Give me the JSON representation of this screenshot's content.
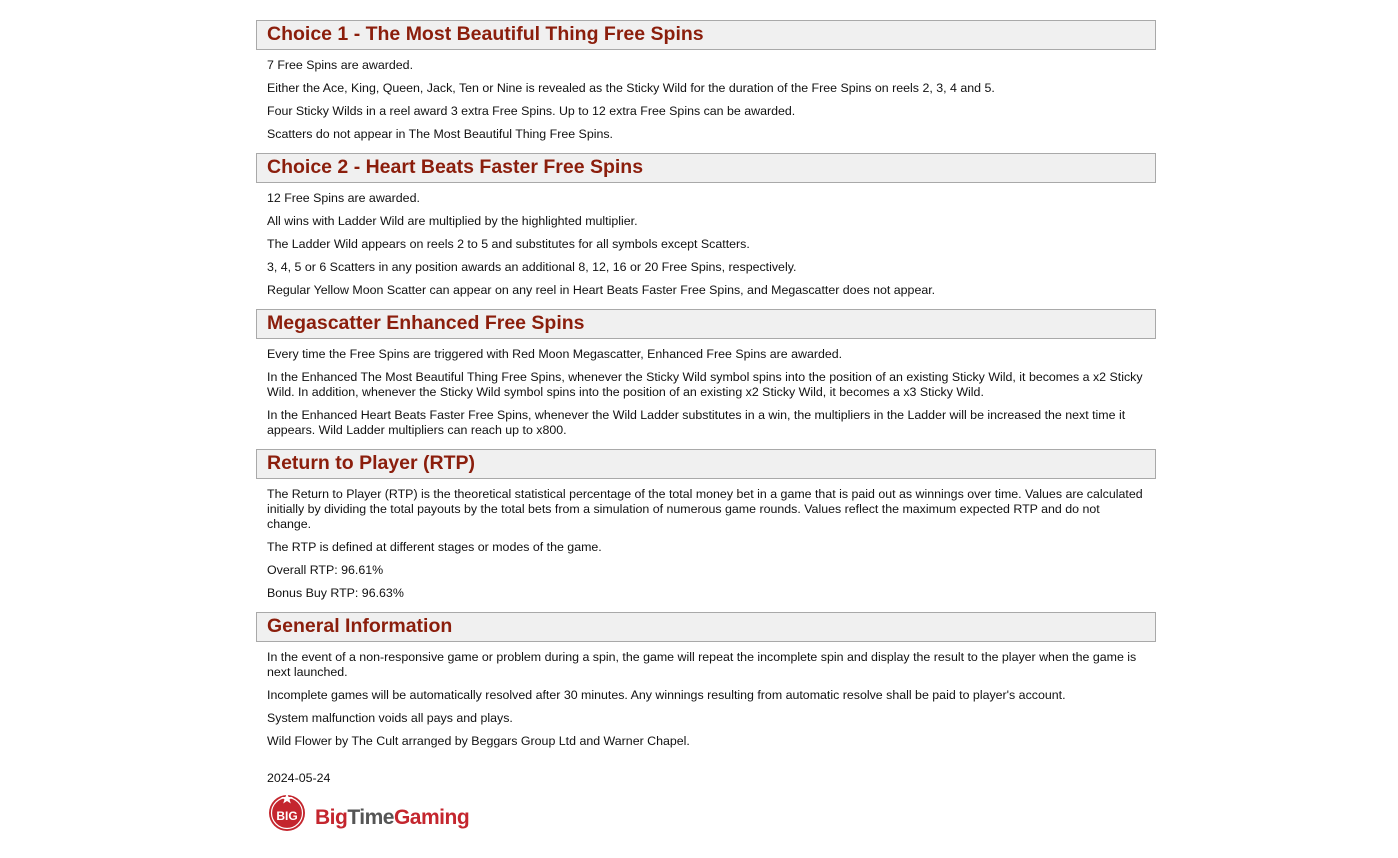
{
  "sections": [
    {
      "title": "Choice 1 - The Most Beautiful Thing Free Spins",
      "paragraphs": [
        "7 Free Spins are awarded.",
        "Either the Ace, King, Queen, Jack, Ten or Nine is revealed as the Sticky Wild for the duration of the Free Spins on reels 2, 3, 4 and 5.",
        "Four Sticky Wilds in a reel award 3 extra Free Spins. Up to 12 extra Free Spins can be awarded.",
        "Scatters do not appear in The Most Beautiful Thing Free Spins."
      ]
    },
    {
      "title": "Choice 2 - Heart Beats Faster Free Spins",
      "paragraphs": [
        "12 Free Spins are awarded.",
        "All wins with Ladder Wild are multiplied by the highlighted multiplier.",
        "The Ladder Wild appears on reels 2 to 5 and substitutes for all symbols except Scatters.",
        "3, 4, 5 or 6 Scatters in any position awards an additional 8, 12, 16 or 20 Free Spins, respectively.",
        "Regular Yellow Moon Scatter can appear on any reel in Heart Beats Faster Free Spins, and Megascatter does not appear."
      ]
    },
    {
      "title": "Megascatter Enhanced Free Spins",
      "paragraphs": [
        "Every time the Free Spins are triggered with Red Moon Megascatter, Enhanced Free Spins are awarded.",
        "In the Enhanced The Most Beautiful Thing Free Spins, whenever the Sticky Wild symbol spins into the position of an existing Sticky Wild, it becomes a x2 Sticky Wild. In addition, whenever the Sticky Wild symbol spins into the position of an existing x2 Sticky Wild, it becomes a x3 Sticky Wild.",
        "In the Enhanced Heart Beats Faster Free Spins, whenever the Wild Ladder substitutes in a win, the multipliers in the Ladder will be increased the next time it appears. Wild Ladder multipliers can reach up to x800."
      ]
    },
    {
      "title": "Return to Player (RTP)",
      "paragraphs": [
        "The Return to Player (RTP) is the theoretical statistical percentage of the total money bet in a game that is paid out as winnings over time. Values are calculated initially by dividing the total payouts by the total bets from a simulation of numerous game rounds. Values reflect the maximum expected RTP and do not change.",
        "The RTP is defined at different stages or modes of the game.",
        "Overall RTP: 96.61%",
        "Bonus Buy RTP: 96.63%"
      ]
    },
    {
      "title": "General Information",
      "paragraphs": [
        "In the event of a non-responsive game or problem during a spin, the game will repeat the incomplete spin and display the result to the player when the game is next launched.",
        "Incomplete games will be automatically resolved after 30 minutes. Any winnings resulting from automatic resolve shall be paid to player's account.",
        "System malfunction voids all pays and plays.",
        "Wild Flower by The Cult arranged by Beggars Group Ltd and Warner Chapel."
      ]
    }
  ],
  "footer": {
    "date": "2024-05-24",
    "logo_badge_text": "BIG",
    "logo_text_1": "Big",
    "logo_text_2": "Time",
    "logo_text_3": "Gaming"
  },
  "colors": {
    "heading": "#8b1e0c",
    "header_bg": "#f0f0f0",
    "header_border": "#a9a9a9",
    "logo_red": "#c4262e"
  }
}
